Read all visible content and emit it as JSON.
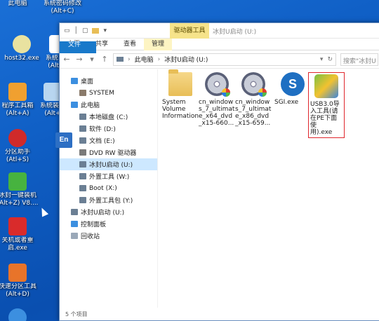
{
  "desktop": {
    "icons": [
      {
        "label": "此电脑",
        "color": "#3c8fe0"
      },
      {
        "label": "系统密码修改\n(Alt+C)",
        "color": "#d9d9d9"
      },
      {
        "label": "host32.exe",
        "color": "#e9e2a0"
      },
      {
        "label": "系统引导\n(Alt+V",
        "color": "#ffffff"
      },
      {
        "label": "程序工具箱\n(Alt+A)",
        "color": "#f0a030"
      },
      {
        "label": "系统装机\n(Alt+",
        "color": "#b8d6f0"
      },
      {
        "label": "分区助手\n(Atl+S)",
        "color": "#d02a2a"
      },
      {
        "label": "冰封一键装机\n(Alt+Z) V8....",
        "color": "#47b33f"
      },
      {
        "label": "关机或者重\n启.exe",
        "color": "#d92b2b"
      },
      {
        "label": "快速分区工具\n(Alt+D)",
        "color": "#e8742a"
      }
    ]
  },
  "window": {
    "qat": [
      "▭",
      "│",
      "▢",
      "▾"
    ],
    "context_tab": "驱动器工具",
    "title": "冰封U启动 (U:)",
    "ribbon_tabs": [
      "文件",
      "主页",
      "共享",
      "查看",
      "管理"
    ],
    "nav_buttons": [
      "←",
      "→",
      "▾",
      "↑"
    ],
    "address": [
      "此电脑",
      "冰封U启动 (U:)"
    ],
    "address_dropdown": "▾",
    "search_placeholder": "搜索\"冰封U",
    "sidebar": [
      {
        "label": "桌面",
        "indent": 0,
        "color": "#3c8fe0"
      },
      {
        "label": "SYSTEM",
        "indent": 1,
        "color": "#8a7a6a"
      },
      {
        "label": "此电脑",
        "indent": 0,
        "color": "#3c8fe0"
      },
      {
        "label": "本地磁盘 (C:)",
        "indent": 1,
        "color": "#6b7f94"
      },
      {
        "label": "软件 (D:)",
        "indent": 1,
        "color": "#6b7f94"
      },
      {
        "label": "文档 (E:)",
        "indent": 1,
        "color": "#6b7f94"
      },
      {
        "label": "DVD RW 驱动器",
        "indent": 1,
        "color": "#7a7a7a"
      },
      {
        "label": "冰封U启动 (U:)",
        "indent": 1,
        "color": "#6b7f94",
        "selected": true
      },
      {
        "label": "外置工具 (W:)",
        "indent": 1,
        "color": "#6b7f94"
      },
      {
        "label": "Boot (X:)",
        "indent": 1,
        "color": "#6b7f94"
      },
      {
        "label": "外置工具包 (Y:)",
        "indent": 1,
        "color": "#6b7f94"
      },
      {
        "label": "冰封U启动 (U:)",
        "indent": 0,
        "color": "#6b7f94"
      },
      {
        "label": "控制面板",
        "indent": 0,
        "color": "#3c8fe0"
      },
      {
        "label": "回收站",
        "indent": 0,
        "color": "#9aa8b8"
      }
    ],
    "files": [
      {
        "label": "System\nVolume\nInformation",
        "kind": "folder"
      },
      {
        "label": "cn_window\ns_7_ultimat\ne_x64_dvd\n_x15-660...",
        "kind": "disc"
      },
      {
        "label": "cn_window\ns_7_ultimat\ne_x86_dvd\n_x15-659...",
        "kind": "disc"
      },
      {
        "label": "SGI.exe",
        "kind": "sgi",
        "icon_text": "S"
      },
      {
        "label": "USB3.0导\n入工具(请\n在PE下面使\n用).exe",
        "kind": "usb",
        "highlighted": true
      }
    ],
    "status": "5 个项目",
    "ime_badge": "En"
  }
}
